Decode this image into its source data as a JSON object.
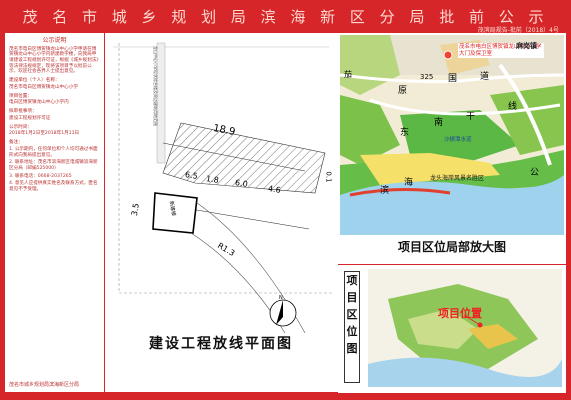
{
  "header": {
    "title": "茂 名 市 城 乡 规 划 局 滨 海 新 区 分 局 批 前 公 示",
    "doc_no": "茂滨局规告-批前（2018）4号"
  },
  "left_panel": {
    "heading": "公示说明",
    "intro": "茂名市电白区博贺镇龙山中心小学申请在博贺镇龙山中心小学内新建教学楼，向我局申请建设工程规划许可证，根据《城乡规划法》等法律法规规定，现将该项目予以批前公示，欢迎社会各界人士提出意见。",
    "applicant_tag": "建设单位（个人）名称：",
    "applicant": "茂名市电白区博贺镇龙山中心小学",
    "location_tag": "项目位置：",
    "location": "电白区博贺镇龙山中心小学内",
    "permit_tag": "拟审批事项：",
    "permit": "建设工程规划许可证",
    "period_tag": "公示时间：",
    "period": "2018年1月2日至2018年1月11日",
    "notes_tag": "备注：",
    "note1": "1. 公示期内，任何单位和个人均可通过书面形式向我局提出意见。",
    "note2": "2. 联系地址：茂名市滨海新区电城镇滨海新区分局（邮编525000）",
    "note3": "3. 联系电话：0668-2037265",
    "note4": "4. 意见人应提供真实姓名及联系方式，匿名意见不予受理。",
    "footer": "茂名市城乡规划局滨海新区分局"
  },
  "drawing": {
    "caption": "建设工程放线平面图",
    "dim_top": "18.9",
    "dim_a": "6.5",
    "dim_b": "1.8",
    "dim_c": "6.0",
    "dim_d": "4.6",
    "dim_e": "0.1",
    "dim_left": "3.5",
    "dim_r": "R1.3",
    "building_label": "新建楼",
    "note_text": "龙山中心小学现状综合楼及周边建筑用地范围",
    "north": "N"
  },
  "map_top": {
    "caption": "项目区位局部放大图",
    "callout": "茂名市电白区博贺镇龙山中心小学大门及保卫室",
    "town": "麻岗镇",
    "road_no": "325",
    "place1": "国",
    "place2": "道",
    "place3": "原",
    "place4": "干",
    "place5": "线",
    "place6": "东",
    "place7": "南",
    "place8": "滨",
    "place9": "海",
    "place10": "公",
    "place11": "沙狮潭水道",
    "place12": "龙头海岸风景名胜区",
    "place13": "茄"
  },
  "map_bottom": {
    "vertical_label": [
      "项",
      "目",
      "区",
      "位",
      "图"
    ],
    "callout": "项目位置"
  }
}
